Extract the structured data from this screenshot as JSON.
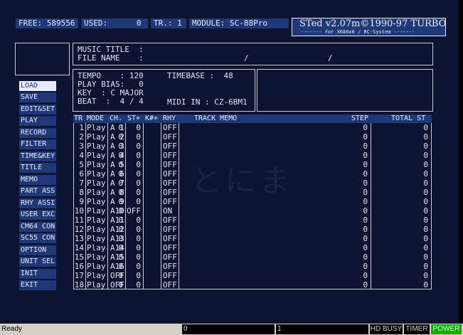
{
  "header": {
    "free": "FREE: 589556",
    "used_label": "USED:",
    "used_value": "0",
    "track": "TR.: 1",
    "module": "MODULE: SC-88Pro",
    "app_title": "STed v2.07m©1990-97 TURBO",
    "app_subtitle": "------- for X680x0 / RC-System -------"
  },
  "info": {
    "music_title_label": "MUSIC TITLE  :",
    "file_name_label": "FILE NAME    :",
    "date_sep1": "/",
    "date_sep2": "/",
    "tempo": "TEMPO    : 120",
    "play_bias": "PLAY BIAS:   0",
    "key": "KEY  : C MAJOR",
    "beat": "BEAT  :  4 / 4",
    "timebase": "TIMEBASE :  48",
    "midi_in": "MIDI IN : CZ-6BM1"
  },
  "menu": [
    "LOAD",
    "SAVE",
    "EDIT&SET",
    "PLAY",
    "RECORD",
    "FILTER",
    "TIME&KEY",
    "TITLE",
    "MEMO",
    "PART ASS",
    "RHY ASSI",
    "USER EXC",
    "CM64 CON",
    "SC55 CON",
    "OPTION",
    "UNIT SEL",
    "INIT",
    "EXIT"
  ],
  "table": {
    "headers": {
      "tr": "TR",
      "mode": "MODE",
      "ch": "CH.",
      "st": "ST+",
      "k": "K#+",
      "rhy": "RHY",
      "memo": "TRACK MEMO",
      "step": "STEP",
      "total": "TOTAL ST"
    },
    "rows": [
      {
        "tr": "1",
        "mode": "Play",
        "ch": "A 1",
        "st": "0",
        "k": "0",
        "rhy": "OFF",
        "step": "0",
        "total": "0"
      },
      {
        "tr": "2",
        "mode": "Play",
        "ch": "A 2",
        "st": "0",
        "k": "0",
        "rhy": "OFF",
        "step": "0",
        "total": "0"
      },
      {
        "tr": "3",
        "mode": "Play",
        "ch": "A 3",
        "st": "0",
        "k": "0",
        "rhy": "OFF",
        "step": "0",
        "total": "0"
      },
      {
        "tr": "4",
        "mode": "Play",
        "ch": "A 4",
        "st": "0",
        "k": "0",
        "rhy": "OFF",
        "step": "0",
        "total": "0"
      },
      {
        "tr": "5",
        "mode": "Play",
        "ch": "A 5",
        "st": "0",
        "k": "0",
        "rhy": "OFF",
        "step": "0",
        "total": "0"
      },
      {
        "tr": "6",
        "mode": "Play",
        "ch": "A 6",
        "st": "0",
        "k": "0",
        "rhy": "OFF",
        "step": "0",
        "total": "0"
      },
      {
        "tr": "7",
        "mode": "Play",
        "ch": "A 7",
        "st": "0",
        "k": "0",
        "rhy": "OFF",
        "step": "0",
        "total": "0"
      },
      {
        "tr": "8",
        "mode": "Play",
        "ch": "A 8",
        "st": "0",
        "k": "0",
        "rhy": "OFF",
        "step": "0",
        "total": "0"
      },
      {
        "tr": "9",
        "mode": "Play",
        "ch": "A 9",
        "st": "0",
        "k": "0",
        "rhy": "OFF",
        "step": "0",
        "total": "0"
      },
      {
        "tr": "10",
        "mode": "Play",
        "ch": "A10",
        "st": "0",
        "k": "OFF",
        "rhy": "ON",
        "step": "0",
        "total": "0"
      },
      {
        "tr": "11",
        "mode": "Play",
        "ch": "A11",
        "st": "0",
        "k": "0",
        "rhy": "OFF",
        "step": "0",
        "total": "0"
      },
      {
        "tr": "12",
        "mode": "Play",
        "ch": "A12",
        "st": "0",
        "k": "0",
        "rhy": "OFF",
        "step": "0",
        "total": "0"
      },
      {
        "tr": "13",
        "mode": "Play",
        "ch": "A13",
        "st": "0",
        "k": "0",
        "rhy": "OFF",
        "step": "0",
        "total": "0"
      },
      {
        "tr": "14",
        "mode": "Play",
        "ch": "A14",
        "st": "0",
        "k": "0",
        "rhy": "OFF",
        "step": "0",
        "total": "0"
      },
      {
        "tr": "15",
        "mode": "Play",
        "ch": "A15",
        "st": "0",
        "k": "0",
        "rhy": "OFF",
        "step": "0",
        "total": "0"
      },
      {
        "tr": "16",
        "mode": "Play",
        "ch": "A16",
        "st": "0",
        "k": "0",
        "rhy": "OFF",
        "step": "0",
        "total": "0"
      },
      {
        "tr": "17",
        "mode": "Play",
        "ch": "OFF",
        "st": "0",
        "k": "0",
        "rhy": "OFF",
        "step": "0",
        "total": "0"
      },
      {
        "tr": "18",
        "mode": "Play",
        "ch": "OFF",
        "st": "0",
        "k": "0",
        "rhy": "OFF",
        "step": "0",
        "total": "0"
      }
    ]
  },
  "watermark": "とにま",
  "statusbar": {
    "ready": "Ready",
    "seg1": "0",
    "seg2": "1",
    "hd_busy": "HD BUSY",
    "timer": "TIMER",
    "power": "POWER"
  },
  "colors": {
    "background": "#0d1330",
    "panel": "#1f3878",
    "power": "#00b000"
  }
}
